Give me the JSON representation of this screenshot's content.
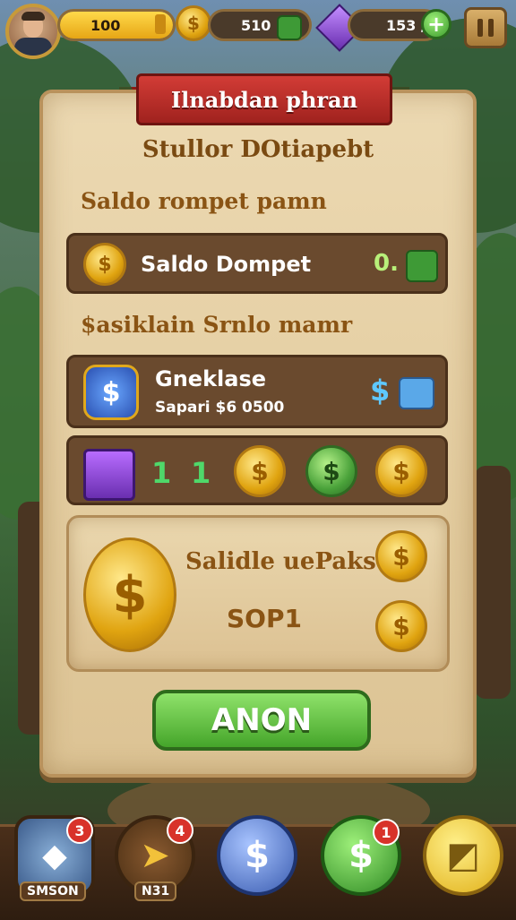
{
  "hud": {
    "energy_value": "100",
    "energy_fill": 1.0,
    "coins_value": "510",
    "gems_value": "153 /"
  },
  "panel": {
    "title": "Ilnabdan phran",
    "subtitle": "Stullor DOtiapebt",
    "section1_label": "Saldo rompet pamn",
    "wallet": {
      "label": "Saldo Dompet",
      "value": "0."
    },
    "section2_label": "$asiklain Srnlo mamr",
    "item": {
      "name": "Gneklase",
      "sub": "Sapari $6 0500",
      "price_symbol": "$"
    },
    "currency_row": {
      "count_a": "1",
      "count_b": "1"
    },
    "big_card": {
      "title": "Salidle uePaks",
      "value": "SOP1"
    },
    "action_label": "ANON"
  },
  "nav": {
    "items": [
      {
        "name": "shield",
        "badge": "3",
        "label": "SMSON"
      },
      {
        "name": "arrow",
        "badge": "4",
        "label": "N31"
      },
      {
        "name": "coin-blue",
        "badge": "",
        "label": ""
      },
      {
        "name": "coin-green",
        "badge": "1",
        "label": ""
      },
      {
        "name": "ticket",
        "badge": "",
        "label": ""
      }
    ]
  },
  "icons": {
    "coin": "dollar-coin-icon",
    "dollar_glyph": "$",
    "plus_glyph": "+"
  },
  "colors": {
    "ribbon": "#c8302b",
    "action": "#5bbf3a",
    "parchment": "#e6d0a4"
  }
}
